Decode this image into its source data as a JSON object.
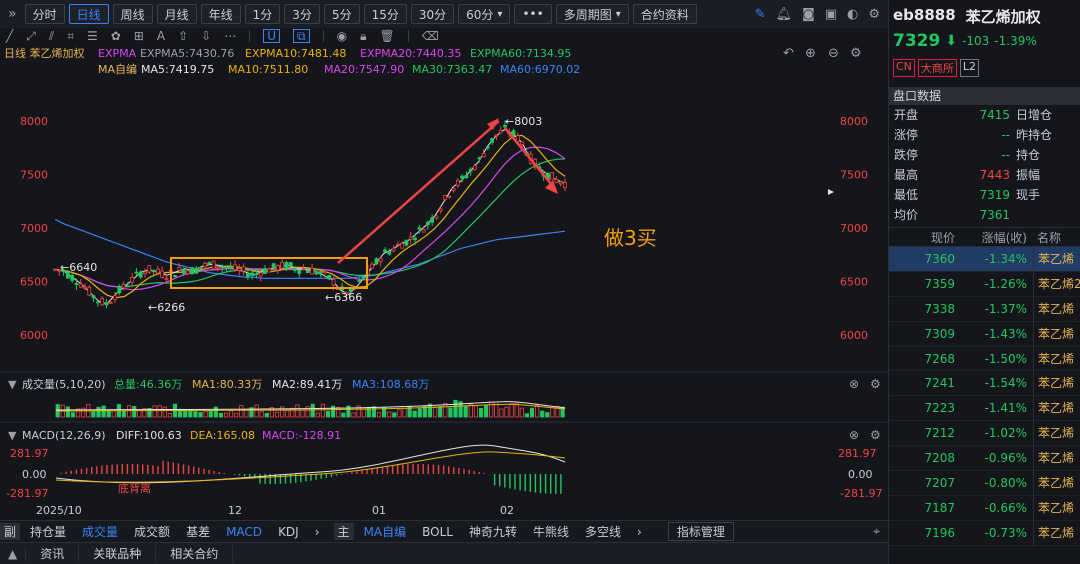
{
  "toolbar": {
    "expand": "»",
    "periods": [
      "分时",
      "日线",
      "周线",
      "月线",
      "年线",
      "1分",
      "3分",
      "5分",
      "15分",
      "30分"
    ],
    "period_60": "60分",
    "more": "•••",
    "multi": "多周期图",
    "contract": "合约资料"
  },
  "chart_header": {
    "title": "日线 苯乙烯加权",
    "expma": {
      "label": "EXPMA",
      "items": [
        "EXPMA5:7430.76",
        "EXPMA10:7481.48",
        "EXPMA20:7440.35",
        "EXPMA60:7134.95"
      ]
    },
    "ma": {
      "label": "MA自编",
      "items": [
        "MA5:7419.75",
        "MA10:7511.80",
        "MA20:7547.90",
        "MA30:7363.47",
        "MA60:6970.02"
      ]
    }
  },
  "colors": {
    "ma5": "#e5e5e5",
    "ma10": "#eab308",
    "ma20": "#d946ef",
    "ma30": "#22c55e",
    "ma60": "#3b82f6",
    "up": "#ef4444",
    "down": "#22c55e",
    "accent": "#3b82f6",
    "box": "#f59e0b"
  },
  "chart_data": {
    "type": "candlestick",
    "price_axis": [
      8000,
      7500,
      7000,
      6500,
      6000
    ],
    "date_axis": [
      "2025/10",
      "12",
      "01",
      "02"
    ],
    "annotations": {
      "high": "8003",
      "low1": "6266",
      "low2": "6366",
      "left": "6640",
      "note": "做3买"
    },
    "ma_series_approx": {
      "ma5": [
        6610,
        6600,
        6540,
        6480,
        6400,
        6320,
        6290,
        6380,
        6450,
        6520,
        6590,
        6610,
        6580,
        6560,
        6590,
        6620,
        6600,
        6640,
        6660,
        6650,
        6630,
        6610,
        6590,
        6560,
        6600,
        6620,
        6640,
        6650,
        6620,
        6610,
        6600,
        6560,
        6520,
        6420,
        6380,
        6460,
        6560,
        6660,
        6760,
        6800,
        6850,
        6890,
        6960,
        7030,
        7120,
        7250,
        7380,
        7440,
        7530,
        7620,
        7760,
        7860,
        7920,
        7880,
        7800,
        7650,
        7560,
        7500,
        7450,
        7420
      ],
      "ma60": [
        7080,
        7040,
        7010,
        6980,
        6950,
        6920,
        6890,
        6860,
        6830,
        6800,
        6770,
        6740,
        6710,
        6680,
        6660,
        6640,
        6620,
        6600,
        6580,
        6570,
        6560,
        6550,
        6540,
        6540,
        6530,
        6530,
        6530,
        6530,
        6530,
        6530,
        6530,
        6530,
        6530,
        6530,
        6530,
        6540,
        6550,
        6560,
        6580,
        6600,
        6620,
        6640,
        6660,
        6690,
        6720,
        6750,
        6780,
        6810,
        6830,
        6850,
        6870,
        6890,
        6900,
        6910,
        6920,
        6930,
        6940,
        6950,
        6960,
        6970
      ]
    },
    "volume": {
      "label": "成交量(5,10,20)",
      "items": [
        "总量:46.36万",
        "MA1:80.33万",
        "MA2:89.41万",
        "MA3:108.68万"
      ]
    },
    "macd": {
      "label": "MACD(12,26,9)",
      "items": [
        "DIFF:100.63",
        "DEA:165.08",
        "MACD:-128.91"
      ],
      "axis": [
        "281.97",
        "0.00",
        "-281.97"
      ],
      "note": "底背离"
    }
  },
  "bottom_tabs1": {
    "label": "副",
    "items": [
      "持仓量",
      "成交量",
      "成交额",
      "基差",
      "MACD",
      "KDJ"
    ],
    "label2": "主",
    "items2": [
      "MA自编",
      "BOLL",
      "神奇九转",
      "牛熊线",
      "多空线"
    ],
    "manage": "指标管理"
  },
  "bottom_tabs2": [
    "资讯",
    "关联品种",
    "相关合约"
  ],
  "right_panel": {
    "code": "eb8888",
    "name": "苯乙烯加权",
    "last": "7329",
    "change": "-103",
    "pct": "-1.39%",
    "tags": [
      "CN",
      "大商所",
      "L2"
    ],
    "section": "盘口数据",
    "quotes": [
      {
        "k": "开盘",
        "v": "7415",
        "k2": "日增仓"
      },
      {
        "k": "涨停",
        "v": "--",
        "k2": "昨持仓"
      },
      {
        "k": "跌停",
        "v": "--",
        "k2": "持仓"
      },
      {
        "k": "最高",
        "v": "7443",
        "k2": "振幅"
      },
      {
        "k": "最低",
        "v": "7319",
        "k2": "现手"
      },
      {
        "k": "均价",
        "v": "7361",
        "k2": ""
      }
    ],
    "list_header": [
      "现价",
      "涨幅(收)",
      "名称"
    ],
    "list": [
      {
        "p": "7360",
        "c": "-1.34%",
        "n": "苯乙烯"
      },
      {
        "p": "7359",
        "c": "-1.26%",
        "n": "苯乙烯2"
      },
      {
        "p": "7338",
        "c": "-1.37%",
        "n": "苯乙烯"
      },
      {
        "p": "7309",
        "c": "-1.43%",
        "n": "苯乙烯"
      },
      {
        "p": "7268",
        "c": "-1.50%",
        "n": "苯乙烯"
      },
      {
        "p": "7241",
        "c": "-1.54%",
        "n": "苯乙烯"
      },
      {
        "p": "7223",
        "c": "-1.41%",
        "n": "苯乙烯"
      },
      {
        "p": "7212",
        "c": "-1.02%",
        "n": "苯乙烯"
      },
      {
        "p": "7208",
        "c": "-0.96%",
        "n": "苯乙烯"
      },
      {
        "p": "7207",
        "c": "-0.80%",
        "n": "苯乙烯"
      },
      {
        "p": "7187",
        "c": "-0.66%",
        "n": "苯乙烯"
      },
      {
        "p": "7196",
        "c": "-0.73%",
        "n": "苯乙烯"
      }
    ]
  }
}
